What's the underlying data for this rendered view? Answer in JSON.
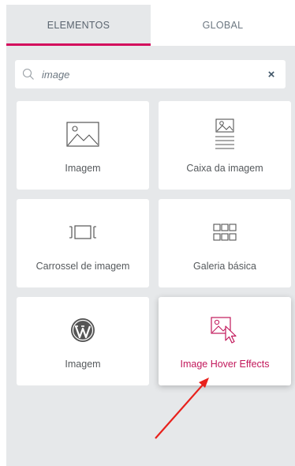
{
  "tabs": [
    {
      "label": "ELEMENTOS",
      "active": true
    },
    {
      "label": "GLOBAL",
      "active": false
    }
  ],
  "search": {
    "value": "image",
    "clear_icon": "×"
  },
  "widgets": [
    {
      "label": "Imagem",
      "icon": "image-icon"
    },
    {
      "label": "Caixa da imagem",
      "icon": "image-box-icon"
    },
    {
      "label": "Carrossel de imagem",
      "icon": "image-carousel-icon"
    },
    {
      "label": "Galeria básica",
      "icon": "gallery-grid-icon"
    },
    {
      "label": "Imagem",
      "icon": "wordpress-icon"
    },
    {
      "label": "Image Hover Effects",
      "icon": "image-hover-cursor-icon",
      "highlighted": true
    }
  ],
  "colors": {
    "accent": "#d30c5c",
    "highlight_label": "#c2185b",
    "panel_bg": "#e6e8ea",
    "annotation_arrow": "#e8211c"
  }
}
